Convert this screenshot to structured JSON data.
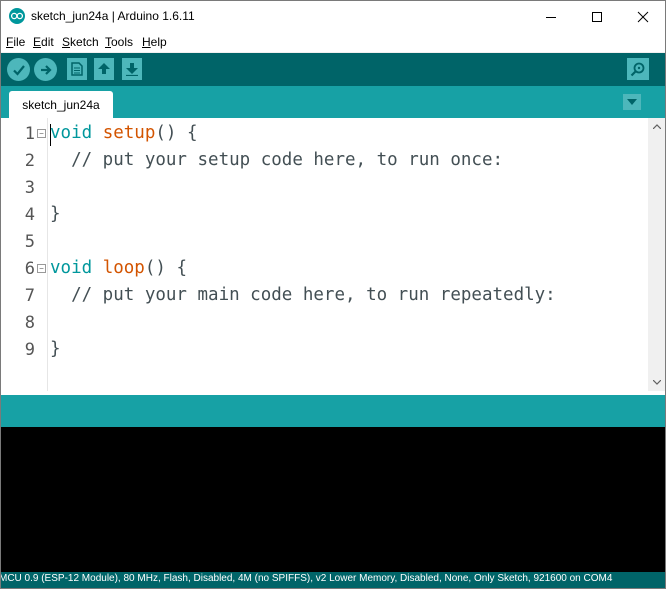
{
  "window": {
    "title": "sketch_jun24a | Arduino 1.6.11"
  },
  "menu": {
    "items": [
      {
        "label": "File",
        "mnemonic": "F",
        "rest": "ile"
      },
      {
        "label": "Edit",
        "mnemonic": "E",
        "rest": "dit"
      },
      {
        "label": "Sketch",
        "mnemonic": "S",
        "rest": "ketch"
      },
      {
        "label": "Tools",
        "mnemonic": "T",
        "rest": "ools"
      },
      {
        "label": "Help",
        "mnemonic": "H",
        "rest": "elp"
      }
    ]
  },
  "toolbar": {
    "icons": [
      "verify-icon",
      "upload-icon",
      "new-icon",
      "open-icon",
      "save-icon",
      "serial-monitor-icon"
    ]
  },
  "tabs": [
    {
      "label": "sketch_jun24a"
    }
  ],
  "editor": {
    "lines": [
      {
        "num": "1",
        "kw": "void",
        "fn": "setup",
        "rest": "() {"
      },
      {
        "num": "2",
        "comment": "  // put your setup code here, to run once:"
      },
      {
        "num": "3"
      },
      {
        "num": "4",
        "text": "}"
      },
      {
        "num": "5"
      },
      {
        "num": "6",
        "kw": "void",
        "fn": "loop",
        "rest": "() {"
      },
      {
        "num": "7",
        "comment": "  // put your main code here, to run repeatedly:"
      },
      {
        "num": "8"
      },
      {
        "num": "9",
        "text": "}"
      }
    ]
  },
  "board_status": "MCU 0.9 (ESP-12 Module), 80 MHz, Flash, Disabled, 4M (no SPIFFS), v2 Lower Memory, Disabled, None, Only Sketch, 921600 on COM4",
  "colors": {
    "toolbar": "#006468",
    "tabstrip": "#17a1a5",
    "button": "#4db7bb",
    "keyword": "#00979c",
    "function": "#d35400"
  }
}
